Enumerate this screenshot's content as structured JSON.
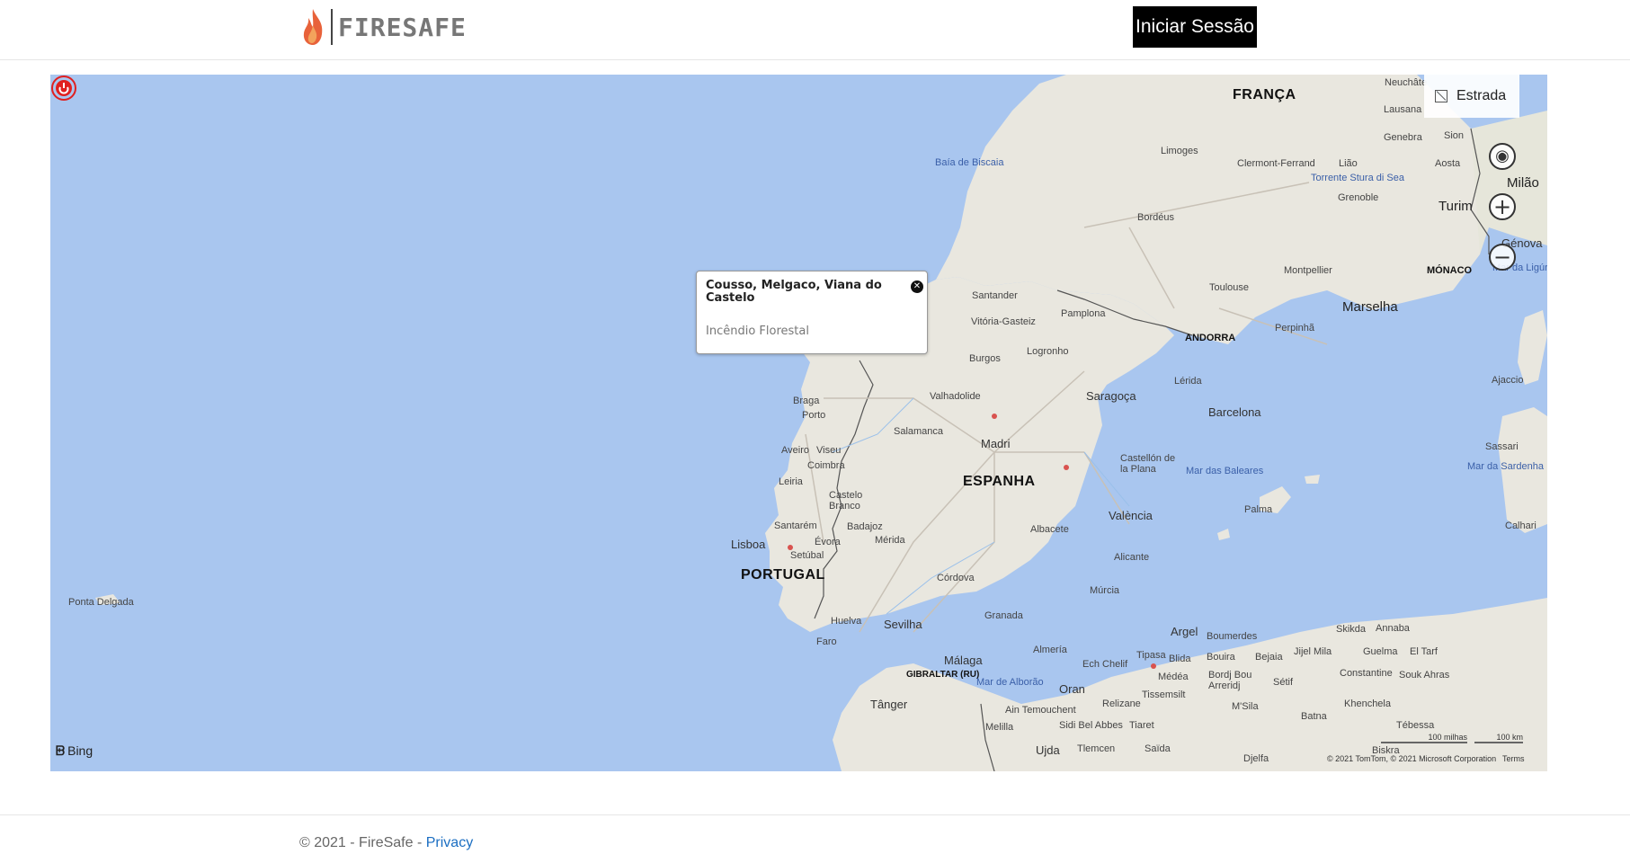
{
  "header": {
    "brand": "FIRESAFE",
    "login_label": "Iniciar Sessão"
  },
  "map": {
    "style_button": "Estrada",
    "controls": {
      "locate": "◉",
      "zoom_in": "+",
      "zoom_out": "−"
    },
    "popup": {
      "title": "Cousso, Melgaco, Viana do Castelo",
      "subtitle": "Incêndio Florestal"
    },
    "bing_label": "Bing",
    "attribution": "© 2021 TomTom, © 2021 Microsoft Corporation",
    "terms": "Terms",
    "scale_miles": "100 milhas",
    "scale_km": "100 km",
    "countries": {
      "france": "FRANÇA",
      "spain": "ESPANHA",
      "portugal": "PORTUGAL",
      "andorra": "ANDORRA",
      "monaco": "MÓNACO",
      "gibraltar": "GIBRALTAR (RU)"
    },
    "seas": {
      "biscay": "Baía de Biscaia",
      "baleares": "Mar das Baleares",
      "alboran": "Mar de Alborão",
      "sardinia": "Mar da Sardenha",
      "liguria": "Mar da Ligúria",
      "torrente": "Torrente Stura di Sea"
    },
    "cities": {
      "neuchatel": "Neuchâte",
      "lausanne": "Lausana",
      "geneva": "Genebra",
      "sion": "Sion",
      "aosta": "Aosta",
      "milan": "Milão",
      "turin": "Turim",
      "genoa": "Génova",
      "grenoble": "Grenoble",
      "limoges": "Limoges",
      "clermont": "Clermont-Ferrand",
      "lyon": "Lião",
      "bordeaux": "Bordéus",
      "toulouse": "Toulouse",
      "montpellier": "Montpellier",
      "marseille": "Marselha",
      "perpignan": "Perpinhã",
      "santander": "Santander",
      "vitoria": "Vitória-Gasteiz",
      "pamplona": "Pamplona",
      "logrono": "Logronho",
      "burgos": "Burgos",
      "valladolid": "Valhadolide",
      "lerida": "Lérida",
      "saragossa": "Saragoça",
      "barcelona": "Barcelona",
      "braga": "Braga",
      "porto": "Porto",
      "aveiro": "Aveiro",
      "viseu": "Viseu",
      "coimbra": "Coimbra",
      "leiria": "Leiria",
      "castelo": "Castelo Branco",
      "santarem": "Santarém",
      "lisboa": "Lisboa",
      "setubal": "Setúbal",
      "evora": "Évora",
      "badajoz": "Badajoz",
      "merida": "Mérida",
      "salamanca": "Salamanca",
      "madrid": "Madri",
      "castellon": "Castellón de la Plana",
      "valencia": "València",
      "albacete": "Albacete",
      "alicante": "Alicante",
      "cordoba": "Córdova",
      "murcia": "Múrcia",
      "granada": "Granada",
      "almeria": "Almería",
      "sevilla": "Sevilha",
      "huelva": "Huelva",
      "faro": "Faro",
      "malaga": "Málaga",
      "tanger": "Tânger",
      "palma": "Palma",
      "ajaccio": "Ajaccio",
      "sassari": "Sassari",
      "cagliari": "Calhari",
      "ponta": "Ponta Delgada",
      "argel": "Argel",
      "boumerdes": "Boumerdes",
      "tipasa": "Tipasa",
      "blida": "Blida",
      "bouira": "Bouira",
      "bejaia": "Bejaia",
      "jijel": "Jijel",
      "mila": "Mila",
      "skikda": "Skikda",
      "annaba": "Annaba",
      "guelma": "Guelma",
      "eltarf": "El Tarf",
      "constantine": "Constantine",
      "soukahras": "Souk Ahras",
      "echchelif": "Ech Chelif",
      "medea": "Médéa",
      "bordj": "Bordj Bou Arreridj",
      "setif": "Sétif",
      "oran": "Oran",
      "relizane": "Relizane",
      "tissemsilt": "Tissemsilt",
      "msila": "M'Sila",
      "khenchela": "Khenchela",
      "batna": "Batna",
      "tebessa": "Tébessa",
      "aintem": "Ain Temouchent",
      "sidibel": "Sidi Bel Abbes",
      "tiaret": "Tiaret",
      "melilla": "Melilla",
      "ujda": "Ujda",
      "tlemcen": "Tlemcen",
      "saida": "Saïda",
      "djelfa": "Djelfa",
      "biskra": "Biskra"
    },
    "colors": {
      "sea": "#a9c6ef",
      "land": "#e9e7df",
      "border": "#555555",
      "marker": "#e02020"
    }
  },
  "footer": {
    "copyright": "© 2021 - FireSafe -",
    "privacy": "Privacy"
  }
}
